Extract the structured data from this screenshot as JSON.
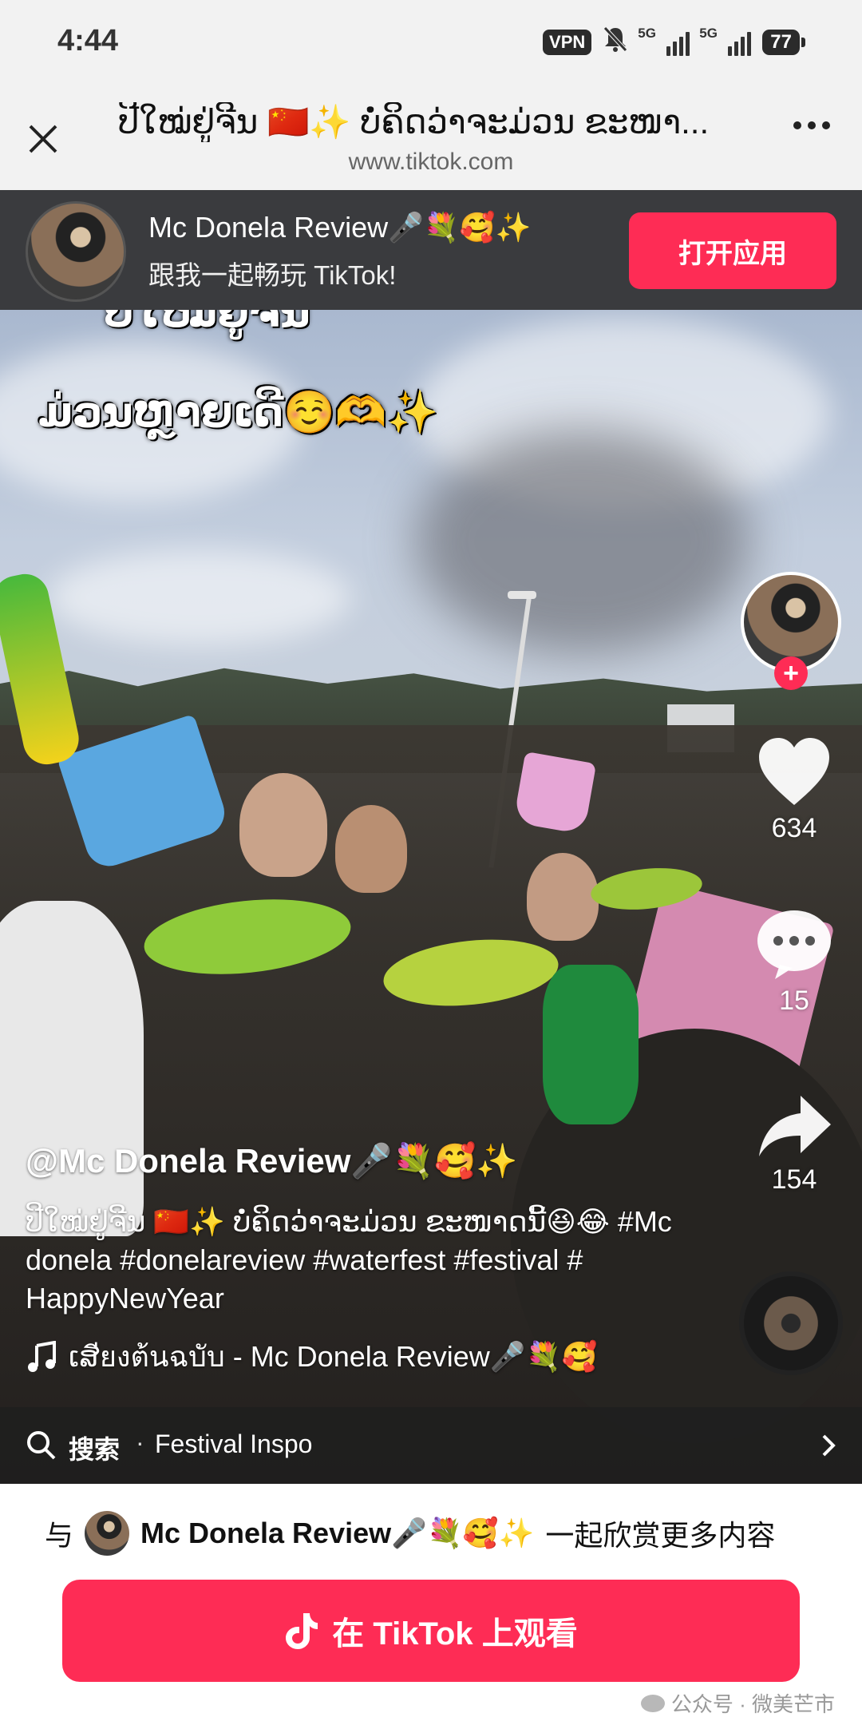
{
  "status_bar": {
    "time": "4:44",
    "vpn": "VPN",
    "network1": "5G",
    "network2": "5G",
    "battery": "77"
  },
  "browser": {
    "title": "ປີໃໝ່ຢູ່ຈີນ 🇨🇳✨ ບໍ່ຄິດວ່າຈະມ່ວນ ຂະໜາ...",
    "url": "www.tiktok.com",
    "close_icon": "close-icon",
    "more_icon": "more-icon"
  },
  "app_banner": {
    "name": "Mc Donela Review🎤💐🥰✨",
    "subtitle": "跟我一起畅玩 TikTok!",
    "open_button": "打开应用"
  },
  "video": {
    "overlay_text": "ມ່ວນຫຼາຍເດີ☺️🫶✨",
    "overlay_text_top": "ປີໃໝ່ຢູ່ຈີນ",
    "like_count": "634",
    "comment_count": "15",
    "share_count": "154",
    "caption_user": "@Mc Donela Review🎤💐🥰✨",
    "caption_text": "ປີໃໝ່ຢູ່ຈີນ 🇨🇳✨ ບໍ່ຄິດວ່າຈະມ່ວນ ຂະໜາດນີ້😆😂 #Mc donela #donelareview #waterfest #festival # HappyNewYear",
    "music": "ເສียงต้นฉบับ - Mc Donela Review🎤💐🥰"
  },
  "search_strip": {
    "label": "搜索",
    "separator": "·",
    "query": "Festival Inspo"
  },
  "bottom": {
    "prefix": "与",
    "name": "Mc Donela Review🎤💐🥰✨",
    "suffix": "一起欣赏更多内容",
    "watch_button": "在 TikTok 上观看",
    "watermark": "公众号 · 微美芒市"
  },
  "colors": {
    "brand": "#fe2c55",
    "banner_bg": "#3a3b3e"
  }
}
